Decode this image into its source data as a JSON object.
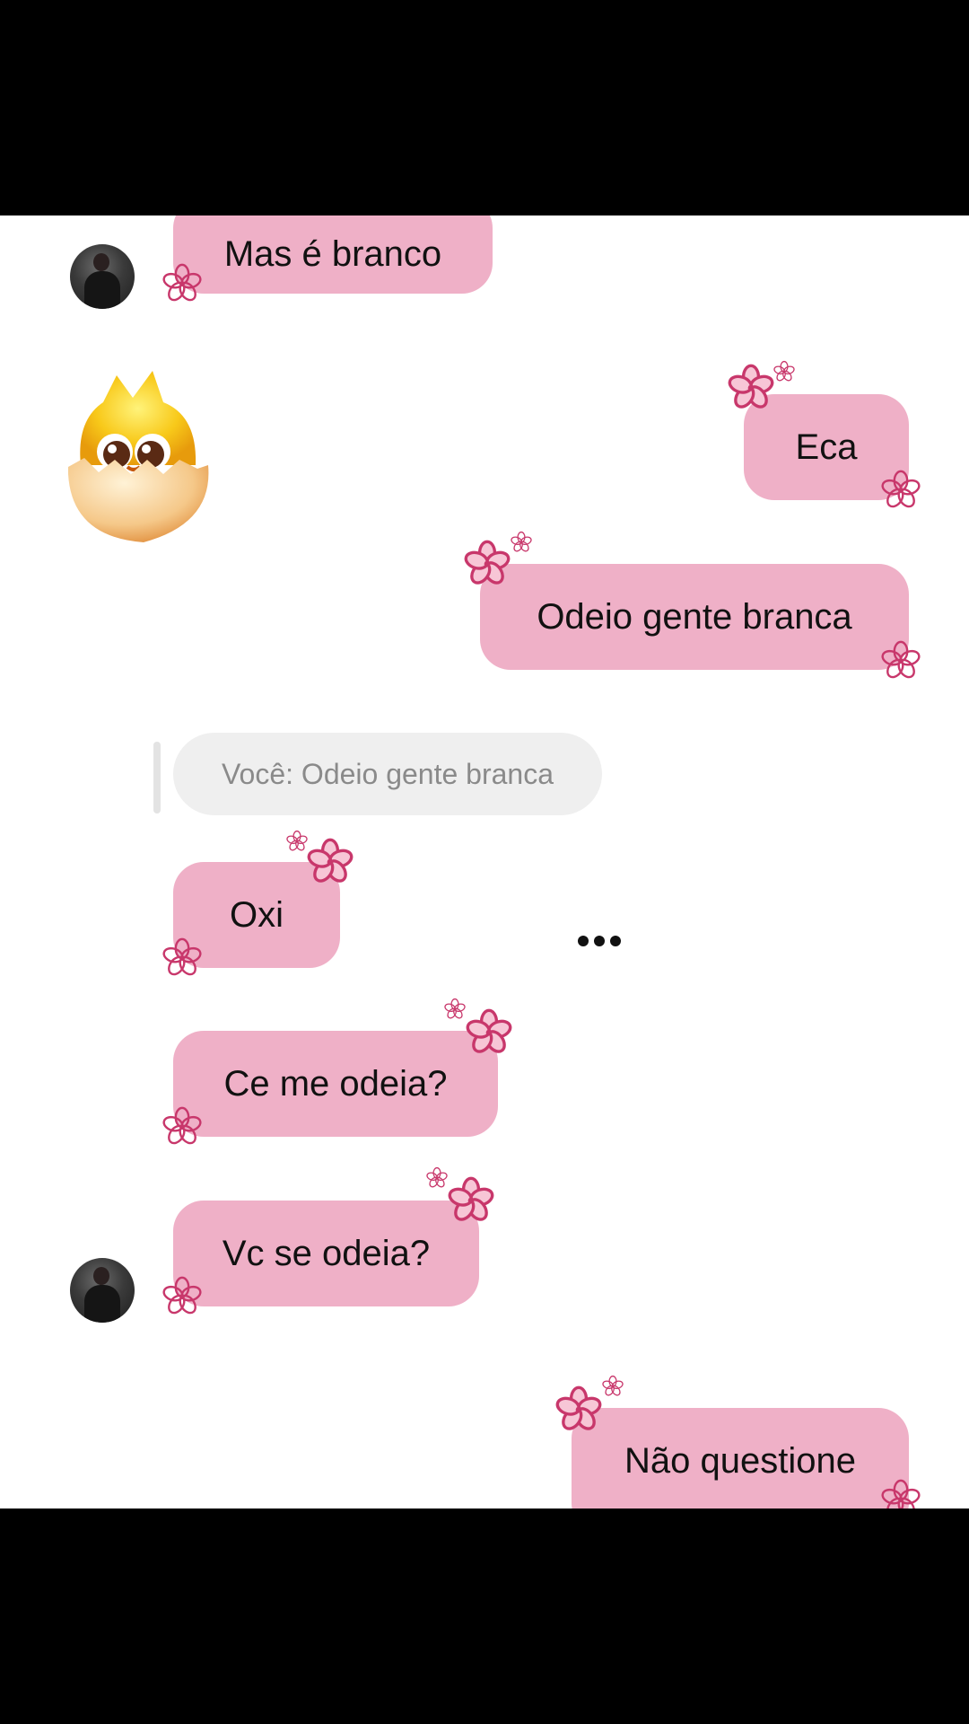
{
  "messages": {
    "m1": "Mas é branco",
    "m2": "Eca",
    "m3": "Odeio gente branca",
    "reply_quote": "Você: Odeio gente branca",
    "m4": "Oxi",
    "m5": "Ce me odeia?",
    "m6": "Vc se odeia?",
    "m7": "Não questione"
  },
  "icons": {
    "avatar": "avatar",
    "emoji": "hatching-chick-emoji",
    "flower": "flower-icon",
    "typing": "typing-indicator"
  },
  "colors": {
    "bubble": "#efb0c7",
    "flower": "#c8376b",
    "quote_bg": "#efefef"
  }
}
